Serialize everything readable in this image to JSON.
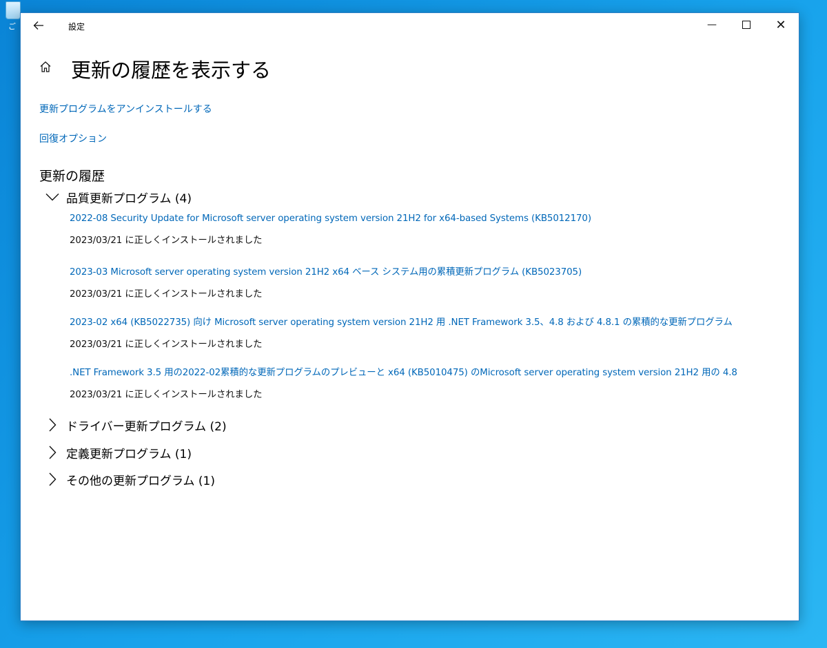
{
  "desktop": {
    "icon_label": "ご"
  },
  "window": {
    "title": "設定",
    "controls": {
      "minimize": "—",
      "close": "✕"
    }
  },
  "page": {
    "title": "更新の履歴を表示する",
    "links": {
      "uninstall": "更新プログラムをアンインストールする",
      "recovery": "回復オプション"
    },
    "history_title": "更新の履歴"
  },
  "groups": [
    {
      "label": "品質更新プログラム (4)",
      "expanded": true,
      "items": [
        {
          "title": "2022-08 Security Update for Microsoft server operating system version 21H2 for x64-based Systems (KB5012170)",
          "status": "2023/03/21 に正しくインストールされました"
        },
        {
          "title": "2023-03 Microsoft server operating system version 21H2 x64 ベース システム用の累積更新プログラム (KB5023705)",
          "status": "2023/03/21 に正しくインストールされました"
        },
        {
          "title": "2023-02 x64 (KB5022735) 向け Microsoft server operating system version 21H2 用 .NET Framework 3.5、4.8 および 4.8.1 の累積的な更新プログラム",
          "status": "2023/03/21 に正しくインストールされました"
        },
        {
          "title": ".NET Framework 3.5 用の2022-02累積的な更新プログラムのプレビューと x64 (KB5010475) のMicrosoft server operating system version 21H2 用の 4.8",
          "status": "2023/03/21 に正しくインストールされました"
        }
      ]
    },
    {
      "label": "ドライバー更新プログラム (2)",
      "expanded": false
    },
    {
      "label": "定義更新プログラム (1)",
      "expanded": false
    },
    {
      "label": "その他の更新プログラム (1)",
      "expanded": false
    }
  ],
  "colors": {
    "link": "#0067b8",
    "desktop": "#0a84d6",
    "window_border": "#2e7fc4"
  }
}
